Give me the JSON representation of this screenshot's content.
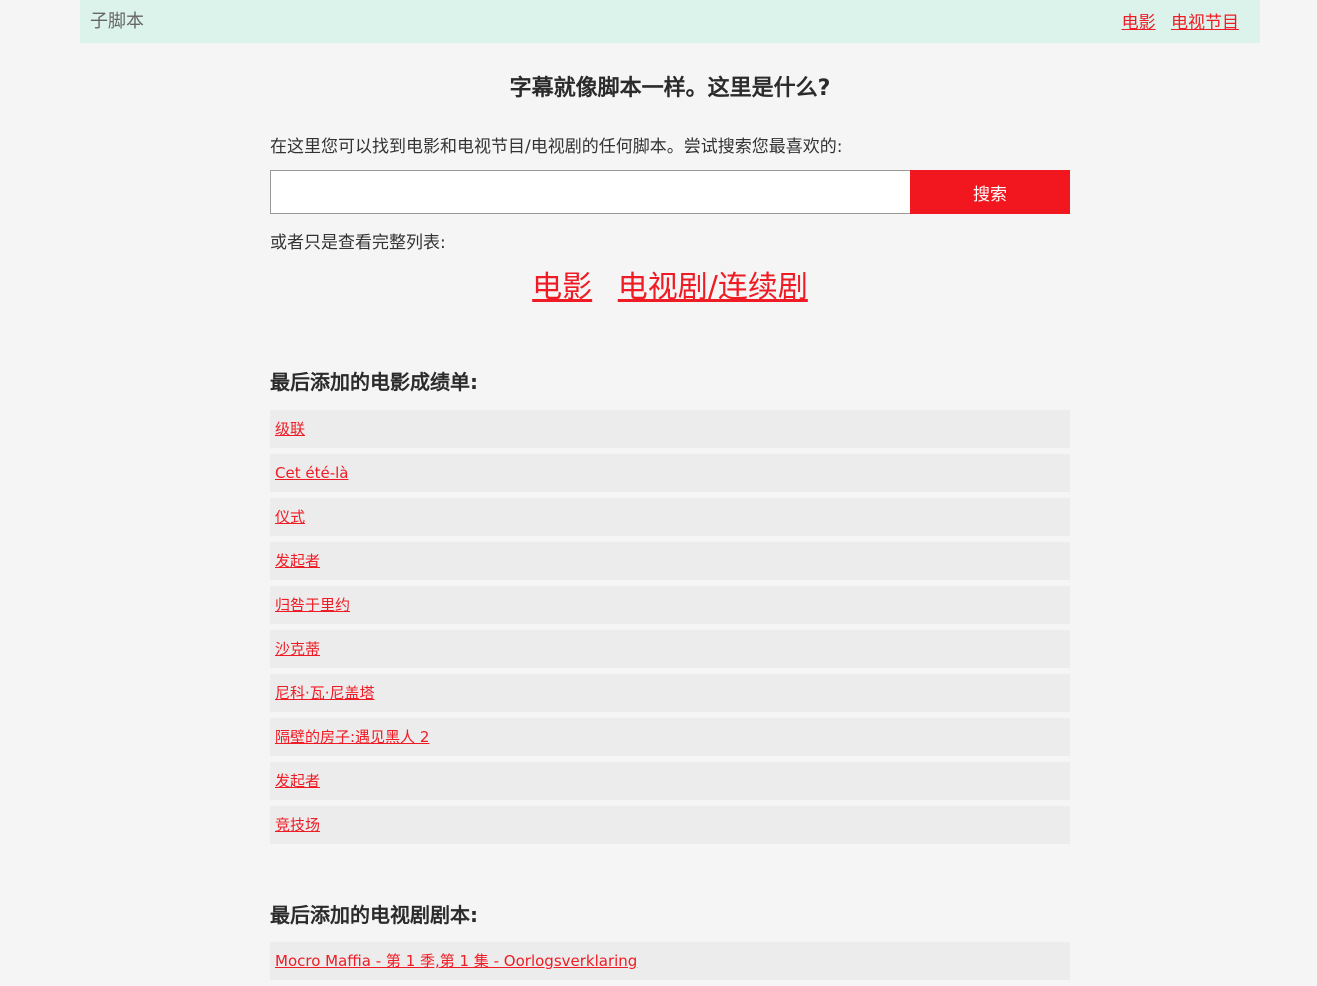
{
  "header": {
    "brand": "子脚本",
    "nav": [
      {
        "label": "电影"
      },
      {
        "label": "电视节目"
      }
    ]
  },
  "main": {
    "headline": "字幕就像脚本一样。这里是什么?",
    "intro": "在这里您可以找到电影和电视节目/电视剧的任何脚本。尝试搜索您最喜欢的:",
    "search": {
      "value": "",
      "placeholder": "",
      "button_label": "搜索"
    },
    "or_text": "或者只是查看完整列表:",
    "big_links": [
      {
        "label": "电影"
      },
      {
        "label": "电视剧/连续剧"
      }
    ],
    "movies_section": {
      "title": "最后添加的电影成绩单:",
      "items": [
        "级联",
        "Cet été-là",
        "仪式",
        "发起者",
        "归咎于里约",
        "沙克蒂",
        "尼科·瓦·尼盖塔",
        "隔壁的房子:遇见黑人 2",
        "发起者",
        "竞技场"
      ]
    },
    "tv_section": {
      "title": "最后添加的电视剧剧本:",
      "items": [
        "Mocro Maffia - 第 1 季,第 1 集 - Oorlogsverklaring"
      ]
    }
  },
  "colors": {
    "accent": "#ef1c25",
    "topbar_bg": "#dcf3ec",
    "page_bg": "#f5f5f5",
    "row_bg": "#ececec"
  }
}
